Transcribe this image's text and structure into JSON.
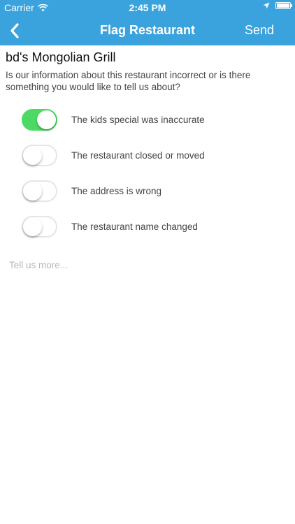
{
  "status_bar": {
    "carrier": "Carrier",
    "time": "2:45 PM"
  },
  "nav": {
    "title": "Flag Restaurant",
    "send_label": "Send",
    "back_icon": "chevron-left-icon"
  },
  "restaurant": {
    "name": "bd's Mongolian Grill"
  },
  "question": "Is our information about this restaurant incorrect or is there something you would like to tell us about?",
  "options": [
    {
      "label": "The kids special was inaccurate",
      "enabled": true
    },
    {
      "label": "The restaurant closed or moved",
      "enabled": false
    },
    {
      "label": "The address is wrong",
      "enabled": false
    },
    {
      "label": "The restaurant name changed",
      "enabled": false
    }
  ],
  "comment": {
    "placeholder": "Tell us more...",
    "value": ""
  },
  "colors": {
    "nav_background": "#3aa3dd",
    "switch_on": "#4cd964",
    "switch_off_border": "#e6e6e6"
  }
}
